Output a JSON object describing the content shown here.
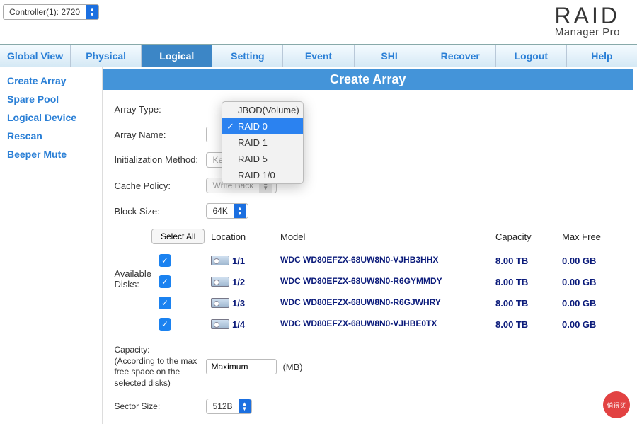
{
  "controller_label": "Controller(1): 2720",
  "brand": {
    "line1": "RAID",
    "line2": "Manager Pro"
  },
  "nav": [
    "Global View",
    "Physical",
    "Logical",
    "Setting",
    "Event",
    "SHI",
    "Recover",
    "Logout",
    "Help"
  ],
  "nav_active": "Logical",
  "sidebar": [
    "Create Array",
    "Spare Pool",
    "Logical Device",
    "Rescan",
    "Beeper Mute"
  ],
  "panel_title": "Create Array",
  "labels": {
    "array_type": "Array Type:",
    "array_name": "Array Name:",
    "init_method": "Initialization Method:",
    "cache_policy": "Cache Policy:",
    "block_size": "Block Size:",
    "available_disks": "Available Disks:",
    "capacity": "Capacity:\n(According to the max free space on the selected disks)",
    "sector_size": "Sector Size:"
  },
  "values": {
    "init_method": "Keep Old Data",
    "cache_policy": "Write Back",
    "block_size": "64K",
    "capacity_value": "Maximum",
    "capacity_unit": "(MB)",
    "sector_size": "512B"
  },
  "array_type_options": [
    "JBOD(Volume)",
    "RAID 0",
    "RAID 1",
    "RAID 5",
    "RAID 1/0"
  ],
  "array_type_selected": "RAID 0",
  "disks": {
    "select_all": "Select All",
    "headers": {
      "location": "Location",
      "model": "Model",
      "capacity": "Capacity",
      "maxfree": "Max Free"
    },
    "rows": [
      {
        "checked": true,
        "location": "1/1",
        "model": "WDC WD80EFZX-68UW8N0-VJHB3HHX",
        "capacity": "8.00 TB",
        "maxfree": "0.00 GB"
      },
      {
        "checked": true,
        "location": "1/2",
        "model": "WDC WD80EFZX-68UW8N0-R6GYMMDY",
        "capacity": "8.00 TB",
        "maxfree": "0.00 GB"
      },
      {
        "checked": true,
        "location": "1/3",
        "model": "WDC WD80EFZX-68UW8N0-R6GJWHRY",
        "capacity": "8.00 TB",
        "maxfree": "0.00 GB"
      },
      {
        "checked": true,
        "location": "1/4",
        "model": "WDC WD80EFZX-68UW8N0-VJHBE0TX",
        "capacity": "8.00 TB",
        "maxfree": "0.00 GB"
      }
    ]
  },
  "watermark": "值得买"
}
